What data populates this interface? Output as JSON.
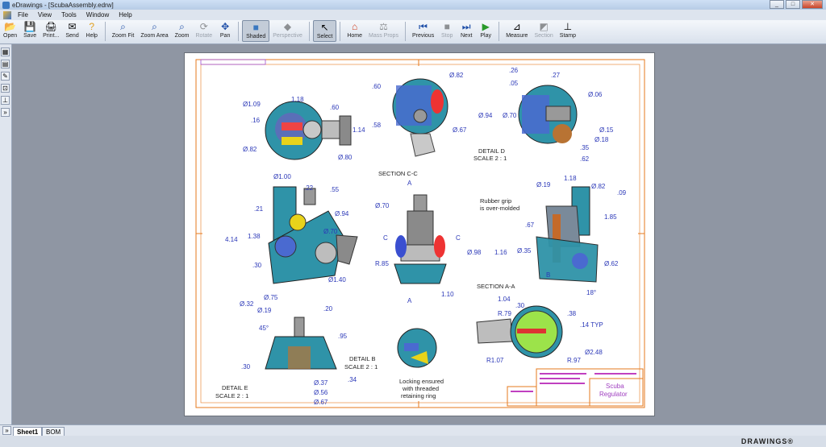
{
  "window": {
    "title": "eDrawings - [ScubaAssembly.edrw]"
  },
  "menu": [
    "File",
    "View",
    "Tools",
    "Window",
    "Help"
  ],
  "toolbar": [
    {
      "label": "Open",
      "icon": "folder-open-icon",
      "disabled": false
    },
    {
      "label": "Save",
      "icon": "save-icon",
      "disabled": false
    },
    {
      "label": "Print...",
      "icon": "print-icon",
      "disabled": false
    },
    {
      "label": "Send",
      "icon": "send-icon",
      "disabled": false
    },
    {
      "label": "Help",
      "icon": "help-icon",
      "disabled": false
    },
    {
      "label": "Zoom Fit",
      "icon": "zoom-fit-icon",
      "disabled": false
    },
    {
      "label": "Zoom Area",
      "icon": "zoom-area-icon",
      "disabled": false
    },
    {
      "label": "Zoom",
      "icon": "zoom-icon",
      "disabled": false
    },
    {
      "label": "Rotate",
      "icon": "rotate-icon",
      "disabled": true
    },
    {
      "label": "Pan",
      "icon": "pan-icon",
      "disabled": false
    },
    {
      "label": "Shaded",
      "icon": "shaded-icon",
      "disabled": false,
      "active": true
    },
    {
      "label": "Perspective",
      "icon": "perspective-icon",
      "disabled": true
    },
    {
      "label": "Select",
      "icon": "select-icon",
      "disabled": false,
      "active": true
    },
    {
      "label": "Home",
      "icon": "home-icon",
      "disabled": false
    },
    {
      "label": "Mass Props",
      "icon": "mass-props-icon",
      "disabled": true
    },
    {
      "label": "Previous",
      "icon": "previous-icon",
      "disabled": false
    },
    {
      "label": "Stop",
      "icon": "stop-icon",
      "disabled": true
    },
    {
      "label": "Next",
      "icon": "next-icon",
      "disabled": false
    },
    {
      "label": "Play",
      "icon": "play-icon",
      "disabled": false
    },
    {
      "label": "Measure",
      "icon": "measure-icon",
      "disabled": false
    },
    {
      "label": "Section",
      "icon": "section-icon",
      "disabled": true
    },
    {
      "label": "Stamp",
      "icon": "stamp-icon",
      "disabled": false
    }
  ],
  "drawing": {
    "section_cc": "SECTION C-C",
    "section_aa": "SECTION A-A",
    "detail_d": "DETAIL D",
    "detail_d_scale": "SCALE 2 : 1",
    "detail_b": "DETAIL B",
    "detail_b_scale": "SCALE 2 : 1",
    "detail_e": "DETAIL E",
    "detail_e_scale": "SCALE 2 : 1",
    "note_rubber": "Rubber grip",
    "note_rubber2": "is over-molded",
    "note_lock1": "Locking ensured",
    "note_lock2": "with threaded",
    "note_lock3": "retaining ring",
    "title_block_name1": "Scuba",
    "title_block_name2": "Regulator",
    "dims": {
      "d118a": "1.18",
      "d109": "Ø1.09",
      "d60": ".60",
      "d16": ".16",
      "d114": "1.14",
      "d82a": "Ø.82",
      "d80": "Ø.80",
      "d60b": ".60",
      "d58": ".58",
      "d82b": "Ø.82",
      "d67": "Ø.67",
      "d26": ".26",
      "d27": ".27",
      "d05": ".05",
      "d94a": "Ø.94",
      "d70a": "Ø.70",
      "d06": "Ø.06",
      "d15": "Ø.15",
      "d18": "Ø.18",
      "d35a": ".35",
      "d62a": ".62",
      "d100": "Ø1.00",
      "d22": ".22",
      "d55": ".55",
      "d21": ".21",
      "d94b": "Ø.94",
      "d414": "4.14",
      "d138": "1.38",
      "d70b": "Ø.70",
      "d30a": ".30",
      "rR85": "R.85",
      "d140": "Ø1.40",
      "d70c": "Ø.70",
      "dA1": "A",
      "dC1": "C",
      "dC2": "C",
      "d98": "Ø.98",
      "d110": "1.10",
      "dA2": "A",
      "d19": "Ø.19",
      "d118b": "1.18",
      "d82c": "Ø.82",
      "d09": ".09",
      "d185": "1.85",
      "d67b": ".67",
      "d116": "1.16",
      "d35b": "Ø.35",
      "d62b": "Ø.62",
      "d18deg": "18°",
      "dB": "B",
      "d75": "Ø.75",
      "d32": "Ø.32",
      "d19b": "Ø.19",
      "d20": ".20",
      "d45": "45°",
      "d95": ".95",
      "d30b": ".30",
      "d37": "Ø.37",
      "d56": "Ø.56",
      "d67c": "Ø.67",
      "d34": ".34",
      "d104": "1.04",
      "d30c": ".30",
      "R79": "R.79",
      "d38": ".38",
      "d14": ".14 TYP",
      "R107": "R1.07",
      "R97": "R.97",
      "d248": "Ø2.48"
    }
  },
  "tabs": [
    "Sheet1",
    "BOM"
  ],
  "status": {
    "brand": "DRAWINGS®"
  }
}
